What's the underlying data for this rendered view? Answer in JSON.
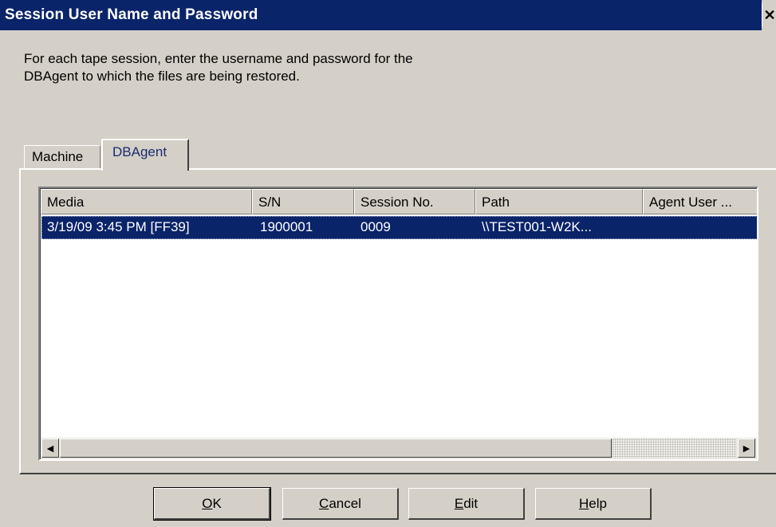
{
  "window": {
    "title": "Session User Name and Password",
    "close_glyph": "✕"
  },
  "instructions": {
    "line1": "For each tape session, enter the username and password for the",
    "line2": "DBAgent to which the files are being restored."
  },
  "tabs": [
    {
      "label": "Machine",
      "selected": false
    },
    {
      "label": "DBAgent",
      "selected": true
    }
  ],
  "table": {
    "columns": [
      "Media",
      "S/N",
      "Session No.",
      "Path",
      "Agent User ..."
    ],
    "rows": [
      {
        "media": "3/19/09 3:45 PM [FF39]",
        "sn": "1900001",
        "session_no": "0009",
        "path": "\\\\TEST001-W2K...",
        "agent_user": "",
        "selected": true
      }
    ]
  },
  "scrollbar": {
    "left_arrow": "◀",
    "right_arrow": "▶"
  },
  "buttons": {
    "ok": {
      "mnemonic": "O",
      "rest": "K"
    },
    "cancel": {
      "mnemonic": "C",
      "rest": "ancel"
    },
    "edit": {
      "mnemonic": "E",
      "rest": "dit"
    },
    "help": {
      "mnemonic": "H",
      "rest": "elp"
    }
  },
  "colors": {
    "titlebar": "#0a246a",
    "selection": "#0a246a",
    "face": "#d4d0c8"
  }
}
